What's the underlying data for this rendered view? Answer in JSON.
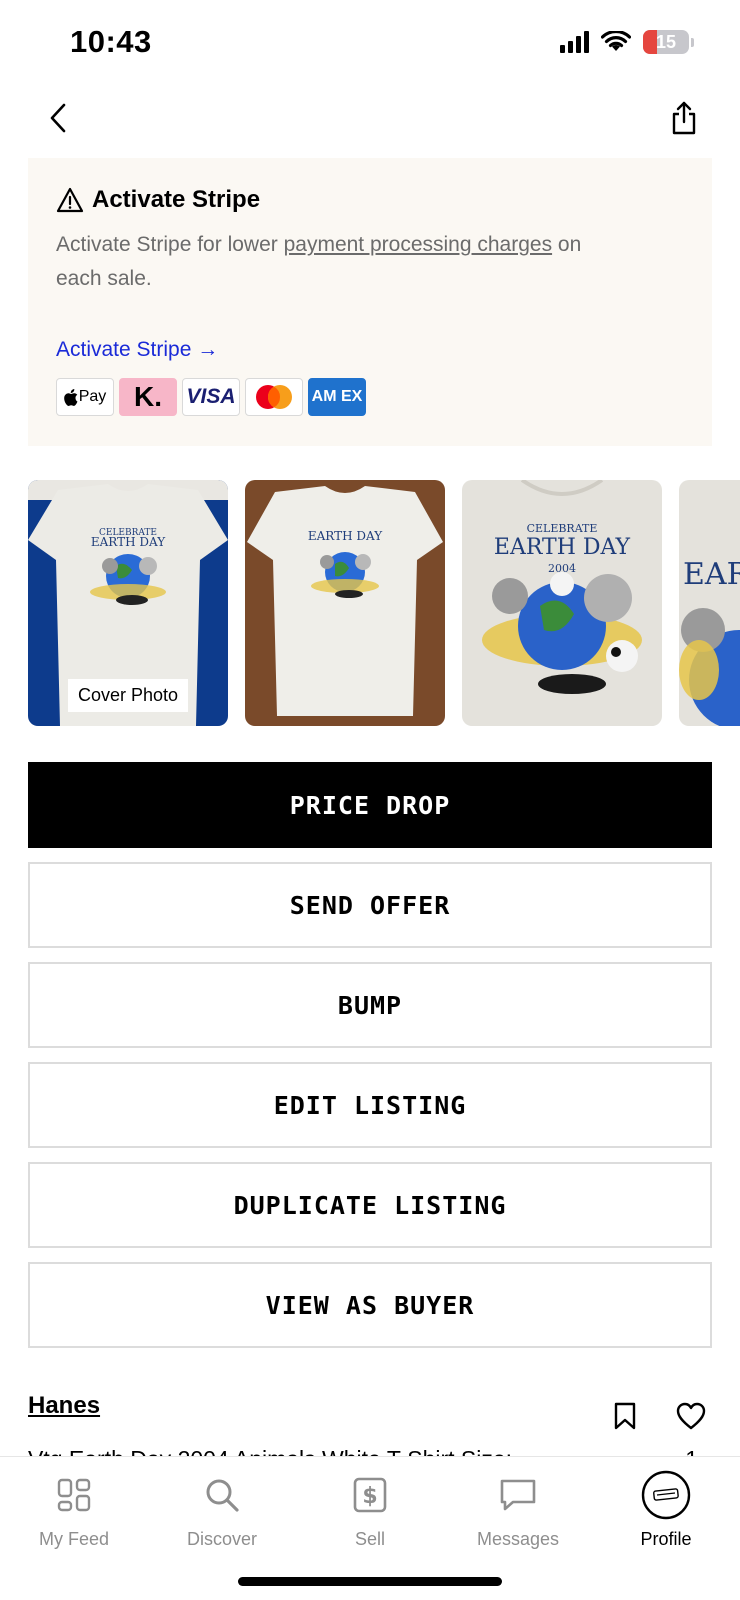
{
  "status_bar": {
    "time": "10:43",
    "battery_level": "15",
    "icons": [
      "signal-icon",
      "wifi-icon",
      "battery-icon"
    ]
  },
  "nav": {
    "back_icon": "chevron-left-icon",
    "share_icon": "share-icon"
  },
  "stripe_banner": {
    "title": "Activate Stripe",
    "warning_icon": "warning-icon",
    "description_prefix": "Activate Stripe for lower ",
    "description_link": "payment processing charges",
    "description_suffix": " on each sale.",
    "cta": "Activate Stripe →",
    "payment_methods": [
      "Pay",
      "K.",
      "VISA",
      "mastercard",
      "AM EX"
    ]
  },
  "photos": {
    "cover_label": "Cover Photo",
    "shirt_text": [
      "CELEBRATE",
      "EARTH DAY",
      "2004"
    ]
  },
  "actions": {
    "price_drop": "PRICE DROP",
    "send_offer": "SEND OFFER",
    "bump": "BUMP",
    "edit_listing": "EDIT LISTING",
    "duplicate_listing": "DUPLICATE LISTING",
    "view_as_buyer": "VIEW AS BUYER"
  },
  "listing": {
    "brand": "Hanes",
    "title": "Vtg Earth Day 2004 Animals White T-Shirt Size:",
    "count": "1"
  },
  "tab_bar": {
    "tabs": [
      {
        "label": "My Feed",
        "icon": "feed-icon"
      },
      {
        "label": "Discover",
        "icon": "search-icon"
      },
      {
        "label": "Sell",
        "icon": "dollar-icon"
      },
      {
        "label": "Messages",
        "icon": "message-icon"
      },
      {
        "label": "Profile",
        "icon": "avatar-icon"
      }
    ],
    "active": "Profile"
  },
  "colors": {
    "banner_bg": "#fbf8f3",
    "link_blue": "#1a2ad8",
    "battery_red": "#e5463f",
    "primary_button": "#000000"
  }
}
